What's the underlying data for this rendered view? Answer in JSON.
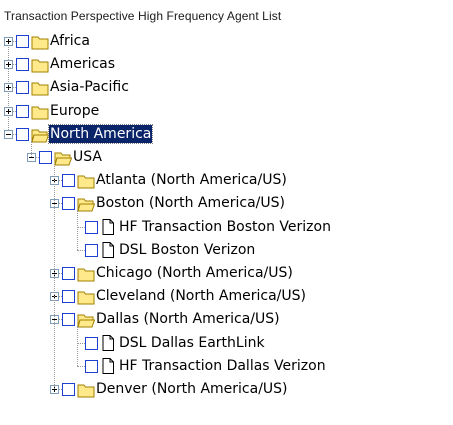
{
  "panel": {
    "title": "Transaction Perspective High Frequency Agent List"
  },
  "tree": [
    {
      "label": "Africa",
      "depth": 0,
      "type": "folder",
      "expanded": false
    },
    {
      "label": "Americas",
      "depth": 0,
      "type": "folder",
      "expanded": false
    },
    {
      "label": "Asia-Pacific",
      "depth": 0,
      "type": "folder",
      "expanded": false
    },
    {
      "label": "Europe",
      "depth": 0,
      "type": "folder",
      "expanded": false
    },
    {
      "label": "North America",
      "depth": 0,
      "type": "folder",
      "expanded": true,
      "selected": true
    },
    {
      "label": "USA",
      "depth": 1,
      "type": "folder",
      "expanded": true
    },
    {
      "label": "Atlanta  (North America/US)",
      "depth": 2,
      "type": "folder",
      "expanded": false
    },
    {
      "label": "Boston  (North America/US)",
      "depth": 2,
      "type": "folder",
      "expanded": true
    },
    {
      "label": "HF Transaction Boston Verizon",
      "depth": 3,
      "type": "file"
    },
    {
      "label": "DSL Boston Verizon",
      "depth": 3,
      "type": "file"
    },
    {
      "label": "Chicago  (North America/US)",
      "depth": 2,
      "type": "folder",
      "expanded": false
    },
    {
      "label": "Cleveland  (North America/US)",
      "depth": 2,
      "type": "folder",
      "expanded": false
    },
    {
      "label": "Dallas  (North America/US)",
      "depth": 2,
      "type": "folder",
      "expanded": true
    },
    {
      "label": "DSL Dallas EarthLink",
      "depth": 3,
      "type": "file"
    },
    {
      "label": "HF Transaction Dallas Verizon",
      "depth": 3,
      "type": "file"
    },
    {
      "label": "Denver  (North America/US)",
      "depth": 2,
      "type": "folder",
      "expanded": false
    }
  ],
  "colors": {
    "folder_fill": "#ffe98a",
    "folder_stroke": "#a08000",
    "checkbox_border": "#1c40cf",
    "selection_bg": "#0a246a"
  }
}
